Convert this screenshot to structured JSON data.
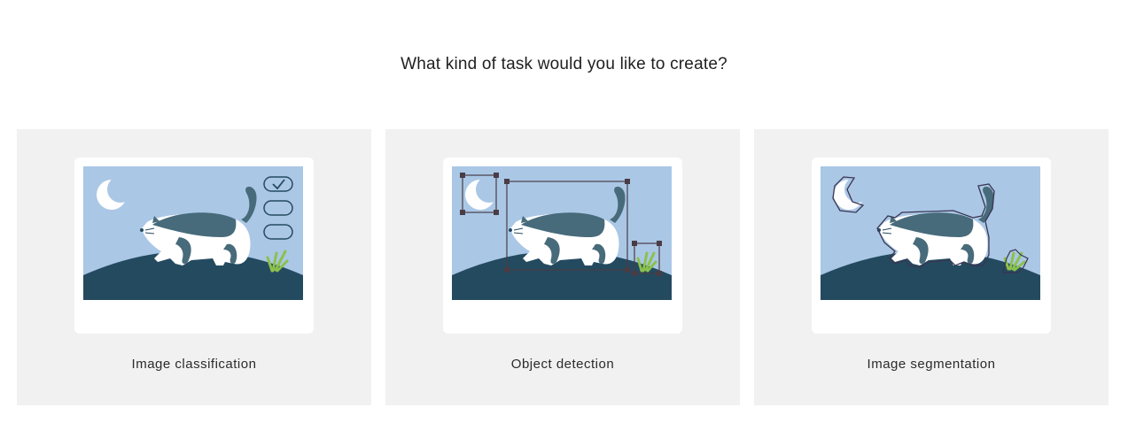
{
  "title": "What kind of task would you like to create?",
  "colors": {
    "sky": "#aac7e6",
    "ground": "#244a60",
    "cat_patch": "#476b7a",
    "grass": "#8cc14c",
    "bbox": "#4a3c45",
    "card_bg": "#f1f1f1"
  },
  "cards": [
    {
      "label": "Image classification",
      "icon": "cat-classification-illustration"
    },
    {
      "label": "Object detection",
      "icon": "cat-object-detection-illustration"
    },
    {
      "label": "Image segmentation",
      "icon": "cat-segmentation-illustration"
    }
  ]
}
